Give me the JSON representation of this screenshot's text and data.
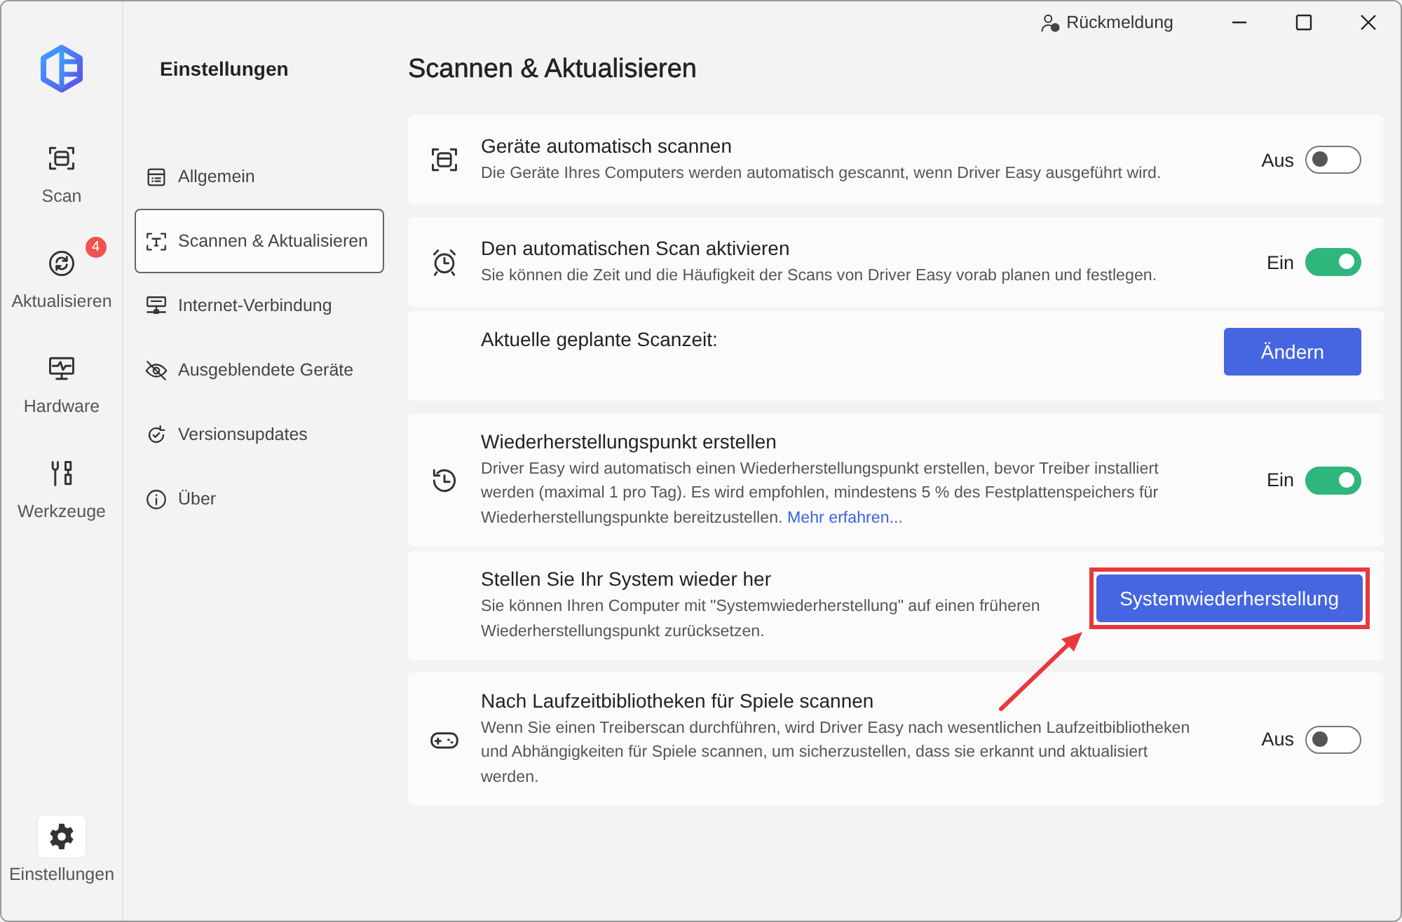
{
  "window": {
    "feedback": "Rückmeldung"
  },
  "rail": {
    "items": [
      {
        "label": "Scan",
        "selected": false
      },
      {
        "label": "Aktualisieren",
        "selected": false,
        "badge": "4"
      },
      {
        "label": "Hardware",
        "selected": false
      },
      {
        "label": "Werkzeuge",
        "selected": false
      }
    ],
    "footer": {
      "label": "Einstellungen",
      "selected": true
    }
  },
  "settings_nav": {
    "title": "Einstellungen",
    "items": [
      {
        "label": "Allgemein",
        "selected": false
      },
      {
        "label": "Scannen & Aktualisieren",
        "selected": true
      },
      {
        "label": "Internet-Verbindung",
        "selected": false
      },
      {
        "label": "Ausgeblendete Geräte",
        "selected": false
      },
      {
        "label": "Versionsupdates",
        "selected": false
      },
      {
        "label": "Über",
        "selected": false
      }
    ]
  },
  "page_title": "Scannen & Aktualisieren",
  "cards": [
    {
      "rows": [
        {
          "kind": "toggle",
          "title": "Geräte automatisch scannen",
          "description": "Die Geräte Ihres Computers werden automatisch gescannt, wenn Driver Easy ausgeführt wird.",
          "state_label": "Aus",
          "on": false
        }
      ]
    },
    {
      "rows": [
        {
          "kind": "toggle",
          "title": "Den automatischen Scan aktivieren",
          "description": "Sie können die Zeit und die Häufigkeit der Scans von Driver Easy vorab planen und festlegen.",
          "state_label": "Ein",
          "on": true
        },
        {
          "kind": "action",
          "title": "Aktuelle geplante Scanzeit:",
          "button": "Ändern",
          "highlighted": false
        }
      ]
    },
    {
      "rows": [
        {
          "kind": "toggle",
          "title": "Wiederherstellungspunkt erstellen",
          "description": "Driver Easy wird automatisch einen Wiederherstellungspunkt erstellen, bevor Treiber installiert werden (maximal 1 pro Tag). Es wird empfohlen, mindestens 5 % des Festplattenspeichers für Wiederherstellungspunkte bereitzustellen.",
          "link": "Mehr erfahren...",
          "state_label": "Ein",
          "on": true
        },
        {
          "kind": "action",
          "title": "Stellen Sie Ihr System wieder her",
          "description": "Sie können Ihren Computer mit \"Systemwiederherstellung\" auf einen früheren Wiederherstellungspunkt zurücksetzen.",
          "button": "Systemwiederherstellung",
          "highlighted": true
        }
      ]
    },
    {
      "rows": [
        {
          "kind": "toggle",
          "title": "Nach Laufzeitbibliotheken für Spiele scannen",
          "description": "Wenn Sie einen Treiberscan durchführen, wird Driver Easy nach wesentlichen Laufzeitbibliotheken und Abhängigkeiten für Spiele scannen, um sicherzustellen, dass sie erkannt und aktualisiert werden.",
          "state_label": "Aus",
          "on": false
        }
      ]
    }
  ]
}
